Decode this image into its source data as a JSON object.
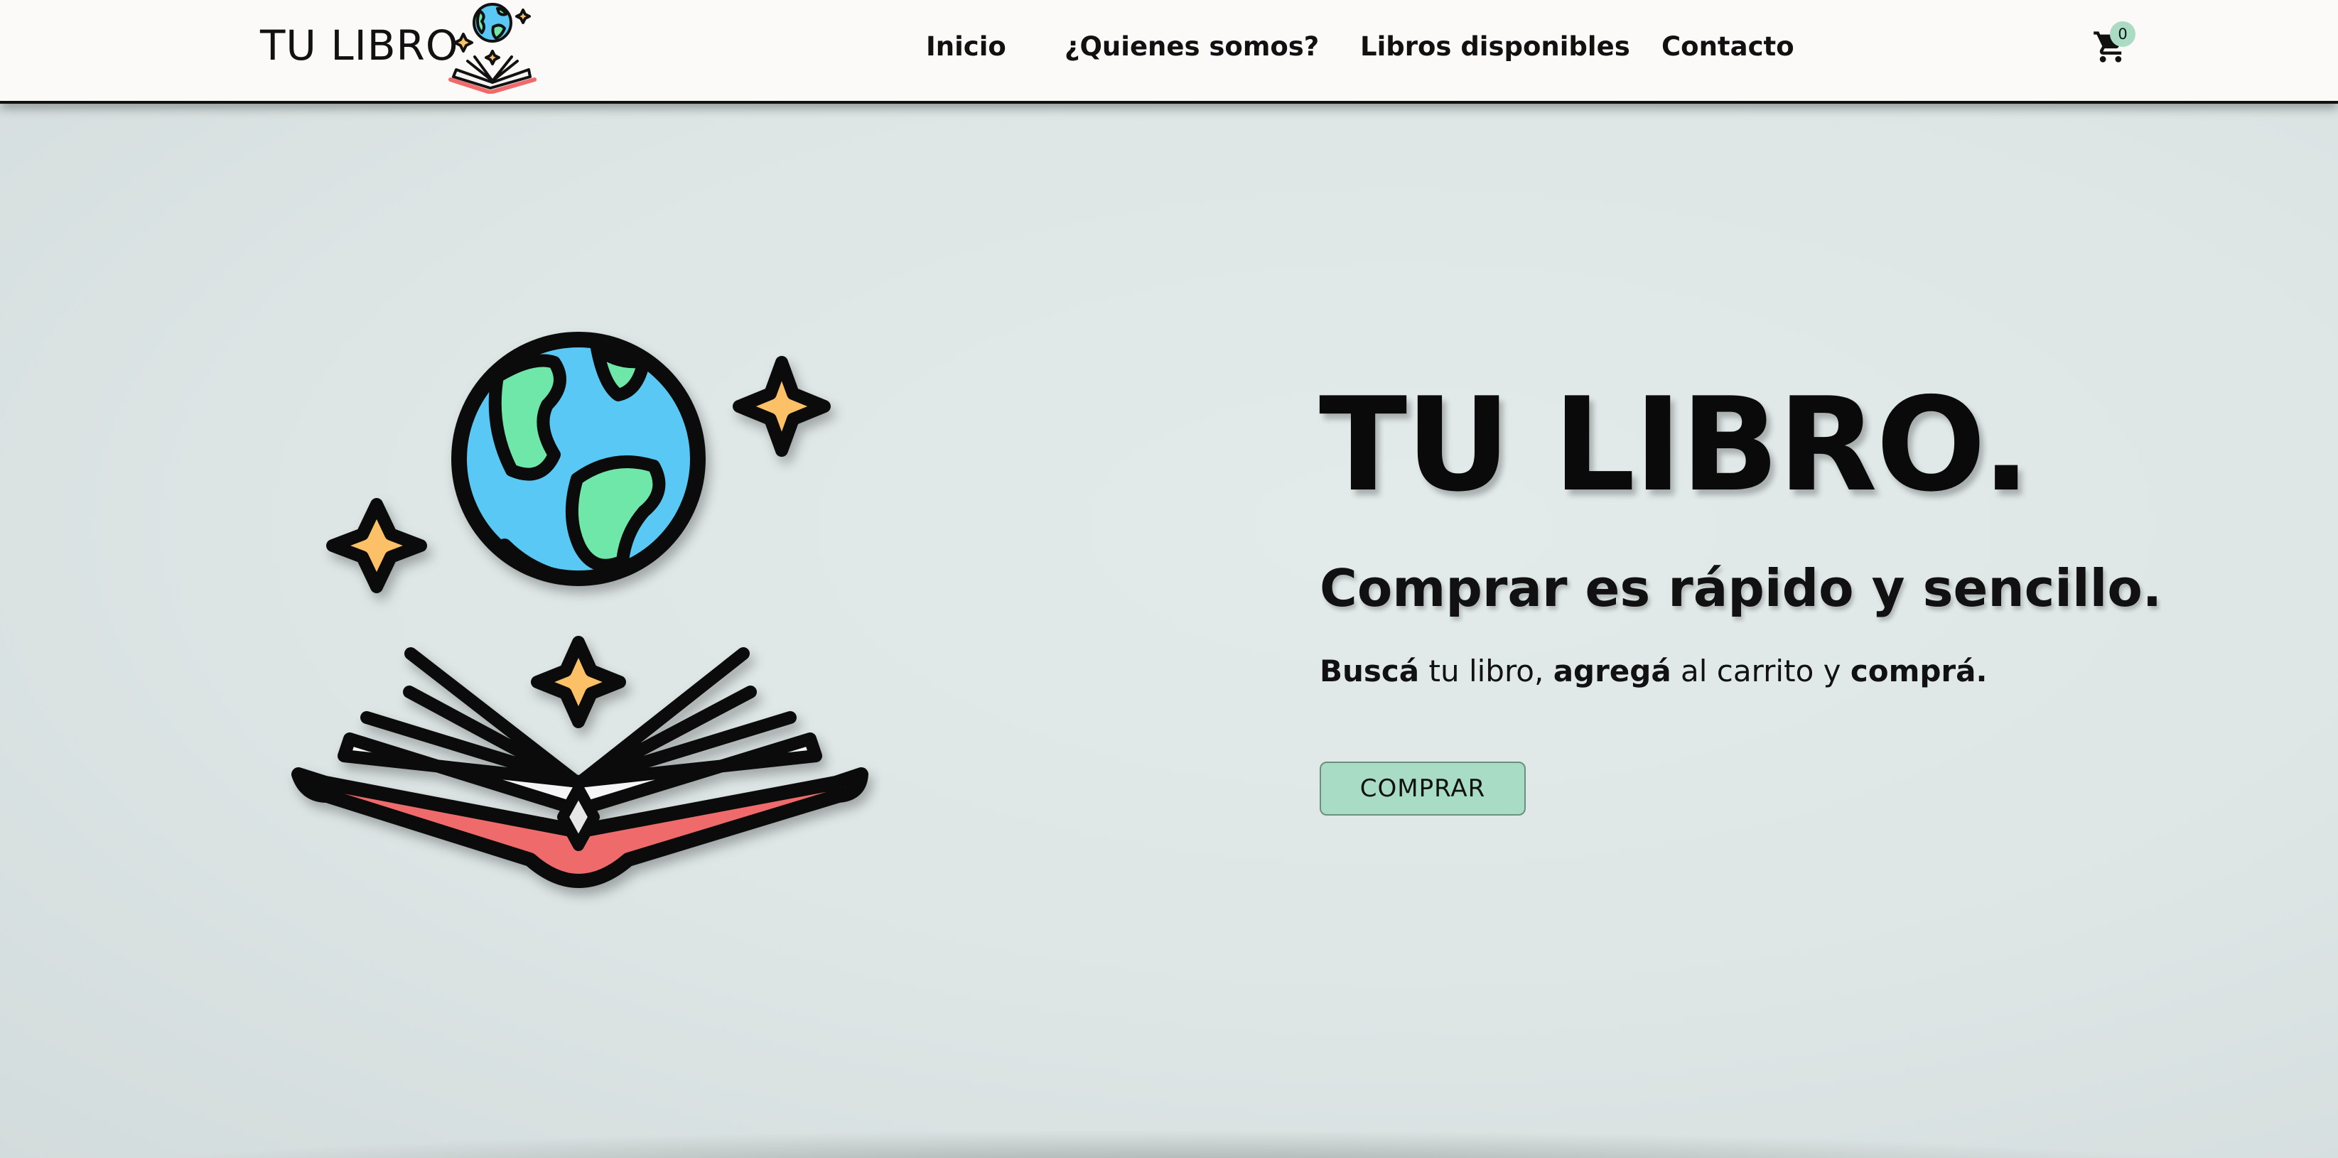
{
  "header": {
    "brand": "TU LIBRO",
    "nav": [
      {
        "label": "Inicio"
      },
      {
        "label": "¿Quienes somos?"
      },
      {
        "label": "Libros disponibles"
      },
      {
        "label": "Contacto"
      }
    ],
    "cart_icon": "shopping-cart-icon",
    "cart_count": "0",
    "logo_icon": "book-globe-logo"
  },
  "hero": {
    "title": "TU LIBRO.",
    "subtitle": "Comprar es rápido y sencillo.",
    "steps": {
      "w1": "Buscá",
      "t1": " tu libro, ",
      "w2": "agregá",
      "t2": " al carrito y ",
      "w3": "comprá."
    },
    "button_label": "COMPRAR",
    "illustration_icon": "open-book-globe-illustration"
  },
  "colors": {
    "header_bg": "#fbfaf8",
    "hero_bg": "#dde6e6",
    "button_bg": "#a8dcc4",
    "badge_bg": "#a9dcc3",
    "globe_blue": "#5ac8f5",
    "land_green": "#6ee7a8",
    "star_yellow": "#fcc067",
    "book_red": "#ef6b6b"
  }
}
